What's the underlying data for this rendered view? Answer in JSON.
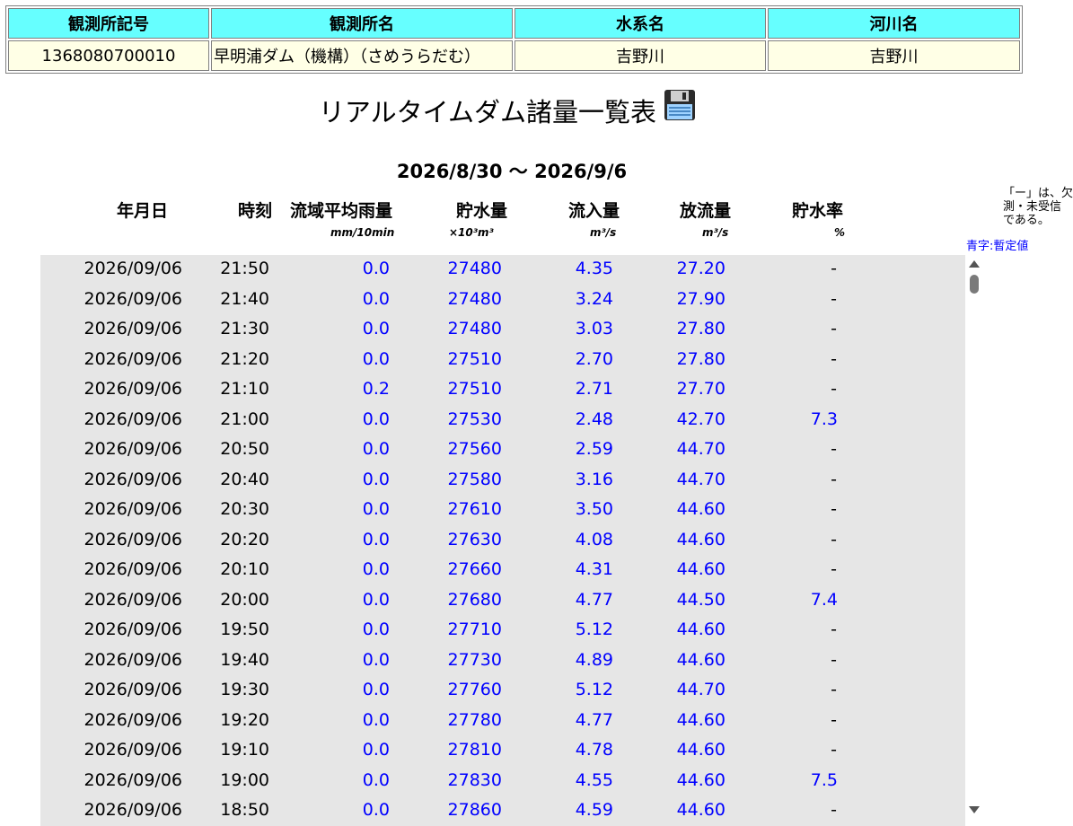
{
  "info": {
    "headers": [
      "観測所記号",
      "観測所名",
      "水系名",
      "河川名"
    ],
    "values": [
      "1368080700010",
      "早明浦ダム（機構）（さめうらだむ）",
      "吉野川",
      "吉野川"
    ]
  },
  "title": "リアルタイムダム諸量一覧表",
  "period": "2026/8/30 〜 2026/9/6",
  "columns": [
    {
      "label": "年月日",
      "unit": ""
    },
    {
      "label": "時刻",
      "unit": ""
    },
    {
      "label": "流域平均雨量",
      "unit": "mm/10min"
    },
    {
      "label": "貯水量",
      "unit": "×10³m³"
    },
    {
      "label": "流入量",
      "unit": "m³/s"
    },
    {
      "label": "放流量",
      "unit": "m³/s"
    },
    {
      "label": "貯水率",
      "unit": "%"
    }
  ],
  "notes": {
    "line1": "「ー」は、欠",
    "line2": "測・未受信",
    "line3": "である。",
    "blue": "青字:暫定値"
  },
  "colors": {
    "header_bg": "#66ffff",
    "cell_bg": "#ffffe6",
    "data_bg": "#e6e6e6",
    "provisional": "#0000ff"
  },
  "rows": [
    {
      "date": "2026/09/06",
      "time": "21:50",
      "rain": "0.0",
      "storage": "27480",
      "inflow": "4.35",
      "outflow": "27.20",
      "rate": "-"
    },
    {
      "date": "2026/09/06",
      "time": "21:40",
      "rain": "0.0",
      "storage": "27480",
      "inflow": "3.24",
      "outflow": "27.90",
      "rate": "-"
    },
    {
      "date": "2026/09/06",
      "time": "21:30",
      "rain": "0.0",
      "storage": "27480",
      "inflow": "3.03",
      "outflow": "27.80",
      "rate": "-"
    },
    {
      "date": "2026/09/06",
      "time": "21:20",
      "rain": "0.0",
      "storage": "27510",
      "inflow": "2.70",
      "outflow": "27.80",
      "rate": "-"
    },
    {
      "date": "2026/09/06",
      "time": "21:10",
      "rain": "0.2",
      "storage": "27510",
      "inflow": "2.71",
      "outflow": "27.70",
      "rate": "-"
    },
    {
      "date": "2026/09/06",
      "time": "21:00",
      "rain": "0.0",
      "storage": "27530",
      "inflow": "2.48",
      "outflow": "42.70",
      "rate": "7.3"
    },
    {
      "date": "2026/09/06",
      "time": "20:50",
      "rain": "0.0",
      "storage": "27560",
      "inflow": "2.59",
      "outflow": "44.70",
      "rate": "-"
    },
    {
      "date": "2026/09/06",
      "time": "20:40",
      "rain": "0.0",
      "storage": "27580",
      "inflow": "3.16",
      "outflow": "44.70",
      "rate": "-"
    },
    {
      "date": "2026/09/06",
      "time": "20:30",
      "rain": "0.0",
      "storage": "27610",
      "inflow": "3.50",
      "outflow": "44.60",
      "rate": "-"
    },
    {
      "date": "2026/09/06",
      "time": "20:20",
      "rain": "0.0",
      "storage": "27630",
      "inflow": "4.08",
      "outflow": "44.60",
      "rate": "-"
    },
    {
      "date": "2026/09/06",
      "time": "20:10",
      "rain": "0.0",
      "storage": "27660",
      "inflow": "4.31",
      "outflow": "44.60",
      "rate": "-"
    },
    {
      "date": "2026/09/06",
      "time": "20:00",
      "rain": "0.0",
      "storage": "27680",
      "inflow": "4.77",
      "outflow": "44.50",
      "rate": "7.4"
    },
    {
      "date": "2026/09/06",
      "time": "19:50",
      "rain": "0.0",
      "storage": "27710",
      "inflow": "5.12",
      "outflow": "44.60",
      "rate": "-"
    },
    {
      "date": "2026/09/06",
      "time": "19:40",
      "rain": "0.0",
      "storage": "27730",
      "inflow": "4.89",
      "outflow": "44.60",
      "rate": "-"
    },
    {
      "date": "2026/09/06",
      "time": "19:30",
      "rain": "0.0",
      "storage": "27760",
      "inflow": "5.12",
      "outflow": "44.70",
      "rate": "-"
    },
    {
      "date": "2026/09/06",
      "time": "19:20",
      "rain": "0.0",
      "storage": "27780",
      "inflow": "4.77",
      "outflow": "44.60",
      "rate": "-"
    },
    {
      "date": "2026/09/06",
      "time": "19:10",
      "rain": "0.0",
      "storage": "27810",
      "inflow": "4.78",
      "outflow": "44.60",
      "rate": "-"
    },
    {
      "date": "2026/09/06",
      "time": "19:00",
      "rain": "0.0",
      "storage": "27830",
      "inflow": "4.55",
      "outflow": "44.60",
      "rate": "7.5"
    },
    {
      "date": "2026/09/06",
      "time": "18:50",
      "rain": "0.0",
      "storage": "27860",
      "inflow": "4.59",
      "outflow": "44.60",
      "rate": "-"
    }
  ]
}
